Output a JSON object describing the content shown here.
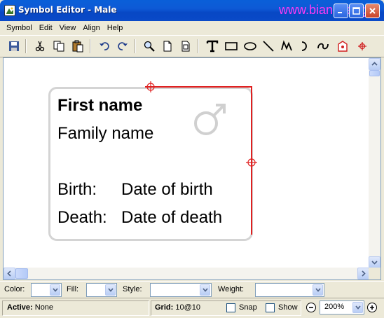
{
  "window": {
    "title": "Symbol Editor - Male",
    "watermark": "www.biancheng"
  },
  "menu": [
    "Symbol",
    "Edit",
    "View",
    "Align",
    "Help"
  ],
  "symbol": {
    "first_name": "First name",
    "family_name": "Family name",
    "birth_label": "Birth:",
    "birth_value": "Date of birth",
    "death_label": "Death:",
    "death_value": "Date of death",
    "gender_icon": "male-symbol-icon"
  },
  "properties": {
    "color_label": "Color:",
    "fill_label": "Fill:",
    "style_label": "Style:",
    "weight_label": "Weight:"
  },
  "status": {
    "active_label": "Active:",
    "active_value": "None",
    "grid_label": "Grid:",
    "grid_value": "10@10",
    "snap_label": "Snap",
    "show_label": "Show",
    "zoom_value": "200%"
  },
  "colors": {
    "selection": "#e02020",
    "card_border": "#d4d4d4",
    "gender_symbol": "#d0d0d0"
  }
}
